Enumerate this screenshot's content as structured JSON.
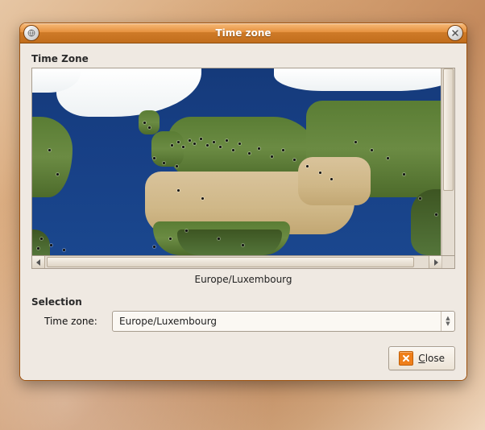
{
  "window": {
    "title": "Time zone"
  },
  "map": {
    "frame_label": "Time Zone",
    "caption": "Europe/Luxembourg"
  },
  "selection": {
    "frame_label": "Selection",
    "tz_label": "Time zone:",
    "tz_value": "Europe/Luxembourg"
  },
  "buttons": {
    "close_label": "Close"
  },
  "colors": {
    "accent": "#cf7b28",
    "window_bg": "#efe9e2"
  },
  "icons": {
    "app": "globe-icon",
    "close_title": "close-icon",
    "close_btn": "cancel-icon"
  }
}
